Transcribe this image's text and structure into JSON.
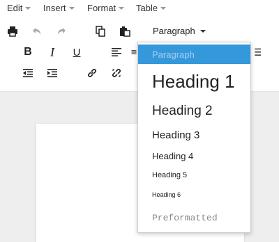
{
  "menubar": {
    "items": [
      {
        "label": "Edit"
      },
      {
        "label": "Insert"
      },
      {
        "label": "Format"
      },
      {
        "label": "Table"
      }
    ]
  },
  "toolbar": {
    "format_select_label": "Paragraph",
    "bold_label": "B",
    "italic_label": "I",
    "underline_label": "U"
  },
  "format_dropdown": {
    "options": [
      {
        "label": "Paragraph",
        "selected": true
      },
      {
        "label": "Heading 1"
      },
      {
        "label": "Heading 2"
      },
      {
        "label": "Heading 3"
      },
      {
        "label": "Heading 4"
      },
      {
        "label": "Heading 5"
      },
      {
        "label": "Heading 6"
      },
      {
        "label": "Preformatted"
      }
    ]
  },
  "colors": {
    "selected_bg": "#3498db",
    "icon": "#222222",
    "icon_disabled": "#aaaaaa"
  }
}
